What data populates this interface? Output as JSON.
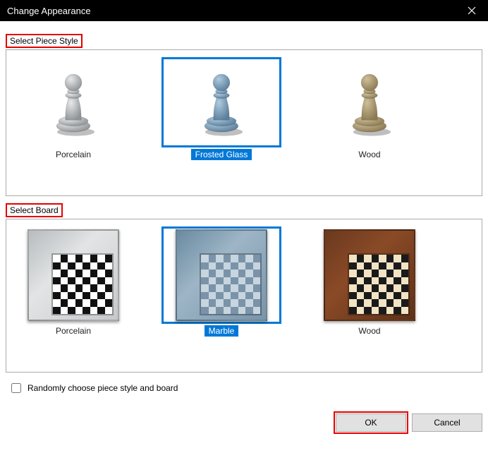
{
  "title": "Change Appearance",
  "section_piece": "Select Piece Style",
  "section_board": "Select Board",
  "random_label": "Randomly choose piece style and board",
  "random_checked": false,
  "piece_styles": [
    {
      "label": "Porcelain",
      "selected": false
    },
    {
      "label": "Frosted Glass",
      "selected": true
    },
    {
      "label": "Wood",
      "selected": false
    }
  ],
  "board_styles": [
    {
      "label": "Porcelain",
      "selected": false
    },
    {
      "label": "Marble",
      "selected": true
    },
    {
      "label": "Wood",
      "selected": false
    }
  ],
  "ok_label": "OK",
  "cancel_label": "Cancel",
  "piece_colors": {
    "porcelain": {
      "light": "#e8e9ea",
      "dark": "#8f9396"
    },
    "frostedglass": {
      "light": "#aecbe0",
      "dark": "#5b7e9a"
    },
    "wood": {
      "light": "#cdbf9a",
      "dark": "#8c7a52"
    }
  }
}
